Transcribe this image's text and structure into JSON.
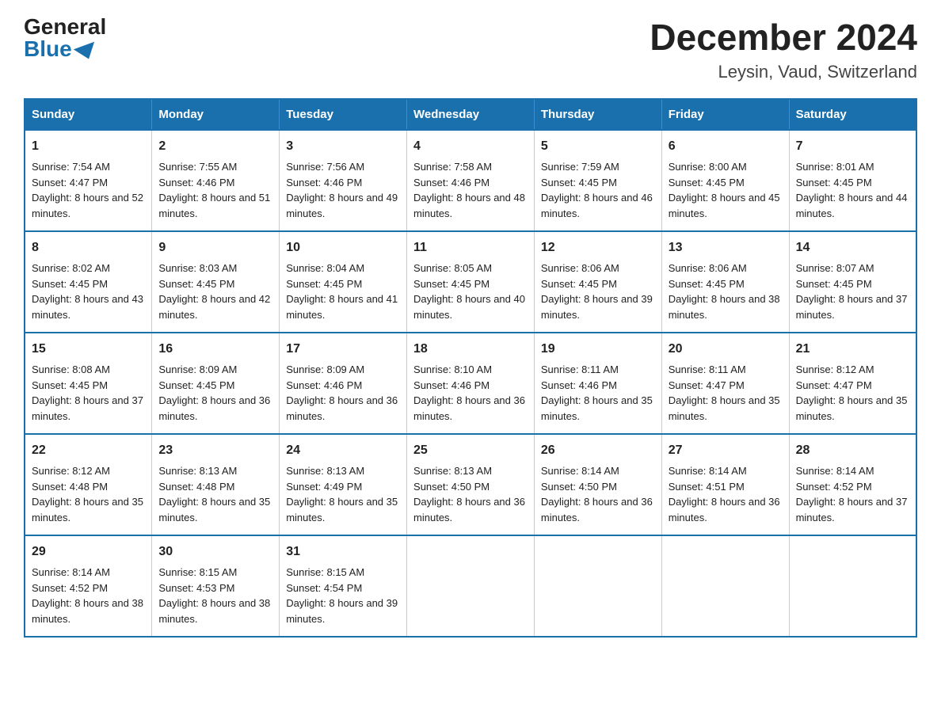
{
  "header": {
    "logo_general": "General",
    "logo_blue": "Blue",
    "title": "December 2024",
    "subtitle": "Leysin, Vaud, Switzerland"
  },
  "days_of_week": [
    "Sunday",
    "Monday",
    "Tuesday",
    "Wednesday",
    "Thursday",
    "Friday",
    "Saturday"
  ],
  "weeks": [
    [
      {
        "day": "1",
        "sunrise": "7:54 AM",
        "sunset": "4:47 PM",
        "daylight": "8 hours and 52 minutes."
      },
      {
        "day": "2",
        "sunrise": "7:55 AM",
        "sunset": "4:46 PM",
        "daylight": "8 hours and 51 minutes."
      },
      {
        "day": "3",
        "sunrise": "7:56 AM",
        "sunset": "4:46 PM",
        "daylight": "8 hours and 49 minutes."
      },
      {
        "day": "4",
        "sunrise": "7:58 AM",
        "sunset": "4:46 PM",
        "daylight": "8 hours and 48 minutes."
      },
      {
        "day": "5",
        "sunrise": "7:59 AM",
        "sunset": "4:45 PM",
        "daylight": "8 hours and 46 minutes."
      },
      {
        "day": "6",
        "sunrise": "8:00 AM",
        "sunset": "4:45 PM",
        "daylight": "8 hours and 45 minutes."
      },
      {
        "day": "7",
        "sunrise": "8:01 AM",
        "sunset": "4:45 PM",
        "daylight": "8 hours and 44 minutes."
      }
    ],
    [
      {
        "day": "8",
        "sunrise": "8:02 AM",
        "sunset": "4:45 PM",
        "daylight": "8 hours and 43 minutes."
      },
      {
        "day": "9",
        "sunrise": "8:03 AM",
        "sunset": "4:45 PM",
        "daylight": "8 hours and 42 minutes."
      },
      {
        "day": "10",
        "sunrise": "8:04 AM",
        "sunset": "4:45 PM",
        "daylight": "8 hours and 41 minutes."
      },
      {
        "day": "11",
        "sunrise": "8:05 AM",
        "sunset": "4:45 PM",
        "daylight": "8 hours and 40 minutes."
      },
      {
        "day": "12",
        "sunrise": "8:06 AM",
        "sunset": "4:45 PM",
        "daylight": "8 hours and 39 minutes."
      },
      {
        "day": "13",
        "sunrise": "8:06 AM",
        "sunset": "4:45 PM",
        "daylight": "8 hours and 38 minutes."
      },
      {
        "day": "14",
        "sunrise": "8:07 AM",
        "sunset": "4:45 PM",
        "daylight": "8 hours and 37 minutes."
      }
    ],
    [
      {
        "day": "15",
        "sunrise": "8:08 AM",
        "sunset": "4:45 PM",
        "daylight": "8 hours and 37 minutes."
      },
      {
        "day": "16",
        "sunrise": "8:09 AM",
        "sunset": "4:45 PM",
        "daylight": "8 hours and 36 minutes."
      },
      {
        "day": "17",
        "sunrise": "8:09 AM",
        "sunset": "4:46 PM",
        "daylight": "8 hours and 36 minutes."
      },
      {
        "day": "18",
        "sunrise": "8:10 AM",
        "sunset": "4:46 PM",
        "daylight": "8 hours and 36 minutes."
      },
      {
        "day": "19",
        "sunrise": "8:11 AM",
        "sunset": "4:46 PM",
        "daylight": "8 hours and 35 minutes."
      },
      {
        "day": "20",
        "sunrise": "8:11 AM",
        "sunset": "4:47 PM",
        "daylight": "8 hours and 35 minutes."
      },
      {
        "day": "21",
        "sunrise": "8:12 AM",
        "sunset": "4:47 PM",
        "daylight": "8 hours and 35 minutes."
      }
    ],
    [
      {
        "day": "22",
        "sunrise": "8:12 AM",
        "sunset": "4:48 PM",
        "daylight": "8 hours and 35 minutes."
      },
      {
        "day": "23",
        "sunrise": "8:13 AM",
        "sunset": "4:48 PM",
        "daylight": "8 hours and 35 minutes."
      },
      {
        "day": "24",
        "sunrise": "8:13 AM",
        "sunset": "4:49 PM",
        "daylight": "8 hours and 35 minutes."
      },
      {
        "day": "25",
        "sunrise": "8:13 AM",
        "sunset": "4:50 PM",
        "daylight": "8 hours and 36 minutes."
      },
      {
        "day": "26",
        "sunrise": "8:14 AM",
        "sunset": "4:50 PM",
        "daylight": "8 hours and 36 minutes."
      },
      {
        "day": "27",
        "sunrise": "8:14 AM",
        "sunset": "4:51 PM",
        "daylight": "8 hours and 36 minutes."
      },
      {
        "day": "28",
        "sunrise": "8:14 AM",
        "sunset": "4:52 PM",
        "daylight": "8 hours and 37 minutes."
      }
    ],
    [
      {
        "day": "29",
        "sunrise": "8:14 AM",
        "sunset": "4:52 PM",
        "daylight": "8 hours and 38 minutes."
      },
      {
        "day": "30",
        "sunrise": "8:15 AM",
        "sunset": "4:53 PM",
        "daylight": "8 hours and 38 minutes."
      },
      {
        "day": "31",
        "sunrise": "8:15 AM",
        "sunset": "4:54 PM",
        "daylight": "8 hours and 39 minutes."
      },
      null,
      null,
      null,
      null
    ]
  ]
}
